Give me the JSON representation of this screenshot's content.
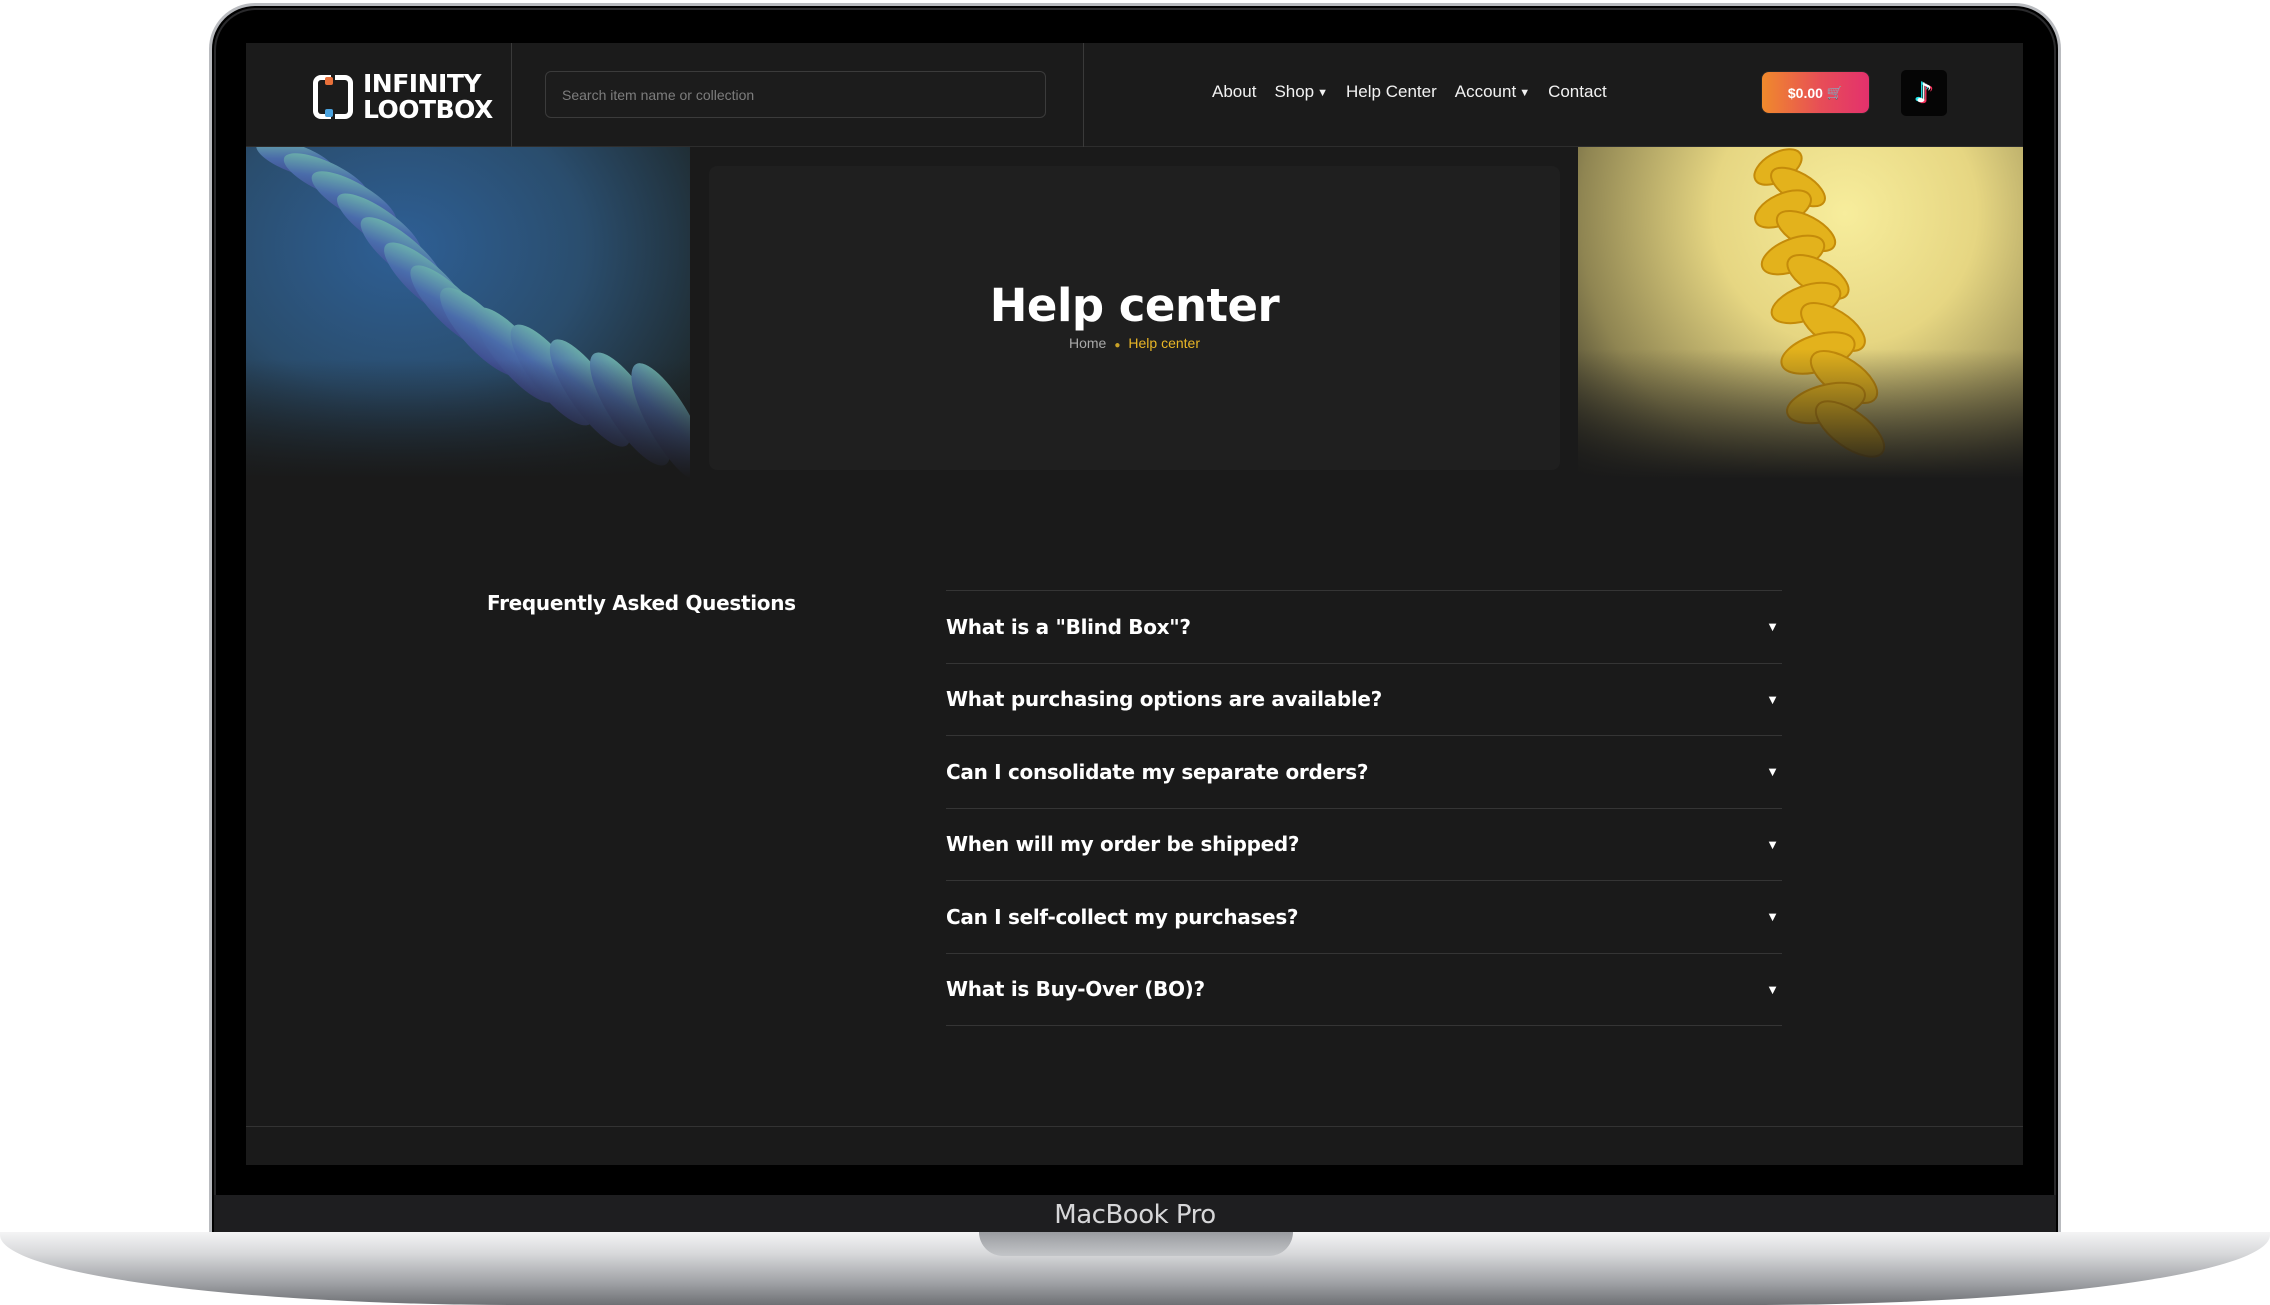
{
  "device": {
    "label": "MacBook Pro"
  },
  "header": {
    "logo": {
      "line1": "INFINITY",
      "line2": "LOOTBOX"
    },
    "search": {
      "placeholder": "Search item name or collection"
    },
    "nav": [
      {
        "label": "About",
        "has_dropdown": false
      },
      {
        "label": "Shop",
        "has_dropdown": true
      },
      {
        "label": "Help Center",
        "has_dropdown": false
      },
      {
        "label": "Account",
        "has_dropdown": true
      },
      {
        "label": "Contact",
        "has_dropdown": false
      }
    ],
    "cart": {
      "amount": "$0.00",
      "icon": "cart-icon"
    },
    "social": {
      "icon": "tiktok-icon"
    }
  },
  "hero": {
    "title": "Help center",
    "breadcrumb": {
      "home": "Home",
      "current": "Help center"
    }
  },
  "faq": {
    "heading": "Frequently Asked Questions",
    "items": [
      {
        "question": "What is a \"Blind Box\"?"
      },
      {
        "question": "What purchasing options are available?"
      },
      {
        "question": "Can I consolidate my separate orders?"
      },
      {
        "question": "When will my order be shipped?"
      },
      {
        "question": "Can I self-collect my purchases?"
      },
      {
        "question": "What is Buy-Over (BO)?"
      }
    ]
  },
  "colors": {
    "background": "#1a1a1a",
    "accent": "#e9b626",
    "cart_gradient_start": "#f08a2c",
    "cart_gradient_end": "#e3316d"
  }
}
